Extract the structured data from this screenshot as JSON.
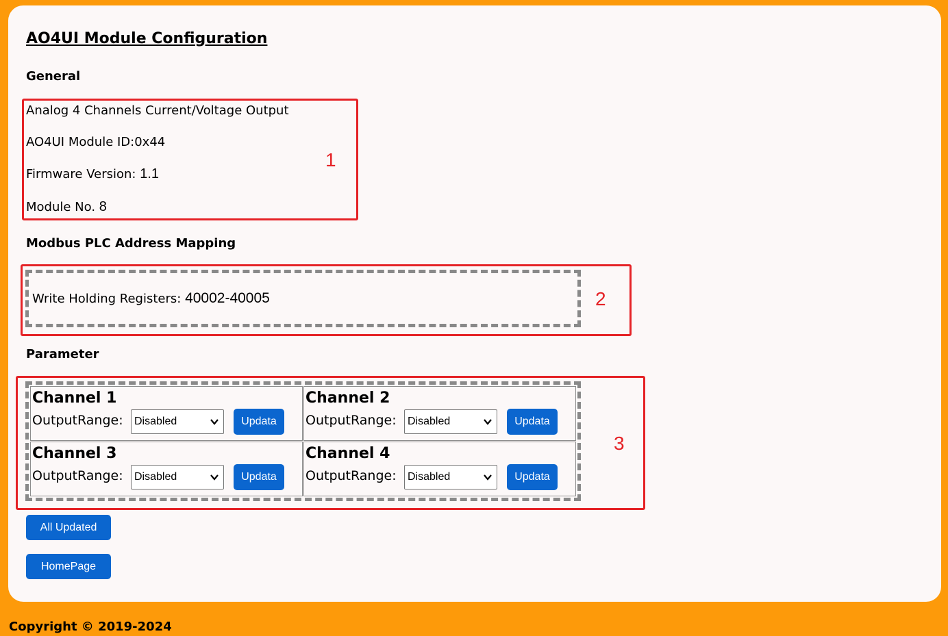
{
  "page_title": "AO4UI Module Configuration",
  "general": {
    "heading": "General",
    "description": "Analog 4 Channels Current/Voltage Output",
    "module_id": "AO4UI Module ID:0x44",
    "firmware_label": "Firmware Version:",
    "firmware_value": "1.1",
    "module_no_label": "Module No.",
    "module_no_value": "8"
  },
  "modbus": {
    "heading": "Modbus PLC Address Mapping",
    "holding_label": "Write Holding Registers:",
    "holding_value": "40002-40005"
  },
  "parameter": {
    "heading": "Parameter",
    "channels": [
      {
        "title": "Channel 1",
        "range_label": "OutputRange:",
        "selected": "Disabled",
        "button": "Updata"
      },
      {
        "title": "Channel 2",
        "range_label": "OutputRange:",
        "selected": "Disabled",
        "button": "Updata"
      },
      {
        "title": "Channel 3",
        "range_label": "OutputRange:",
        "selected": "Disabled",
        "button": "Updata"
      },
      {
        "title": "Channel 4",
        "range_label": "OutputRange:",
        "selected": "Disabled",
        "button": "Updata"
      }
    ]
  },
  "buttons": {
    "all_updated": "All Updated",
    "homepage": "HomePage"
  },
  "annotations": [
    "1",
    "2",
    "3"
  ],
  "footer": "Copyright © 2019-2024",
  "colors": {
    "background": "#fd9a0a",
    "card": "#fcf8f8",
    "accent_button": "#0b66cf",
    "annotation_red": "#e52226",
    "dashed_border": "#898989"
  }
}
